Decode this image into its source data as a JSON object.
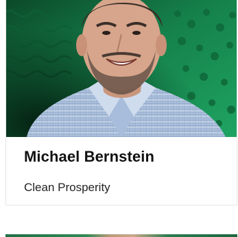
{
  "card": {
    "image_alt": "Portrait of a smiling man in a light blue checked shirt against a green patterned background",
    "name": "Michael Bernstein",
    "organization": "Clean Prosperity"
  },
  "colors": {
    "background_green": "#1e9a5a",
    "dark_green": "#0b3b22",
    "text_primary": "#111111",
    "card_border": "#e6e6e6"
  }
}
